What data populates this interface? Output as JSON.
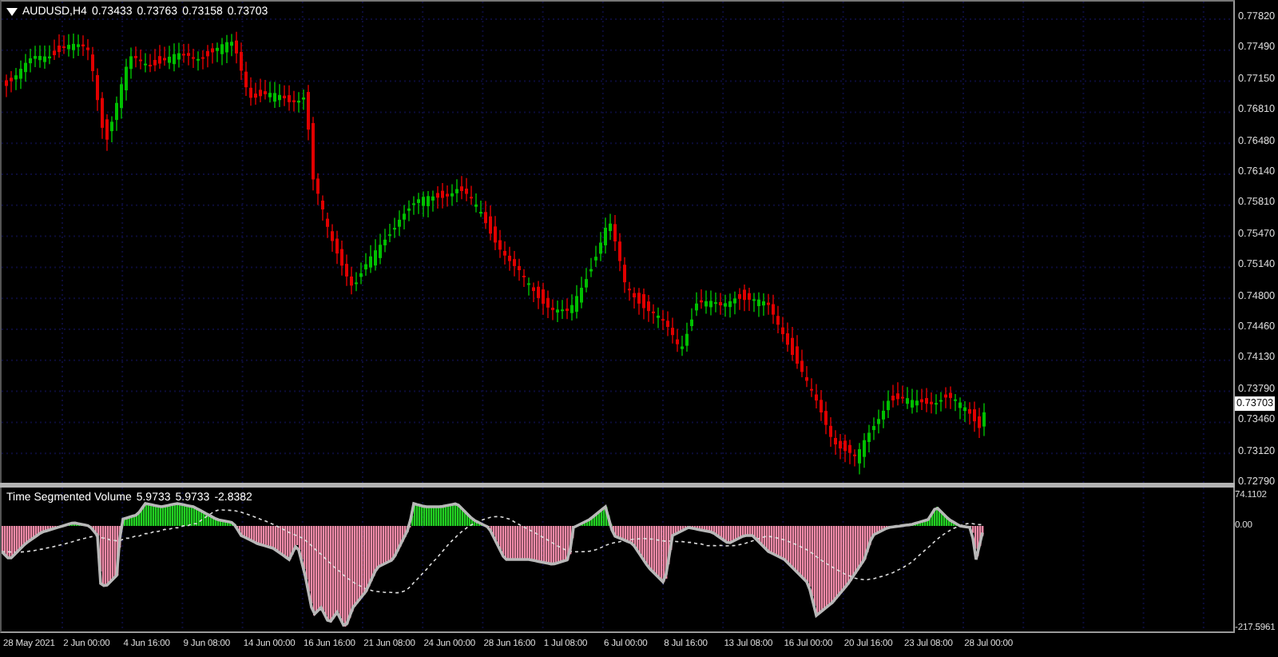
{
  "chart": {
    "symbol": "AUDUSD,H4",
    "ohlc": [
      "0.73433",
      "0.73763",
      "0.73158",
      "0.73703"
    ],
    "price_ticks": [
      "0.77820",
      "0.77490",
      "0.77150",
      "0.76810",
      "0.76480",
      "0.76140",
      "0.75810",
      "0.75470",
      "0.75140",
      "0.74800",
      "0.74460",
      "0.74130",
      "0.73790",
      "0.73460",
      "0.73120",
      "0.72790"
    ],
    "current_price": "0.73703"
  },
  "indicator": {
    "title": "Time Segmented Volume",
    "values": [
      "5.9733",
      "5.9733",
      "-2.8382"
    ],
    "scale_ticks": [
      "74.1102",
      "0.00",
      "-217.5961"
    ]
  },
  "time_axis": {
    "labels": [
      "28 May 2021",
      "2 Jun 00:00",
      "4 Jun 16:00",
      "9 Jun 08:00",
      "14 Jun 00:00",
      "16 Jun 16:00",
      "21 Jun 08:00",
      "24 Jun 00:00",
      "28 Jun 16:00",
      "1 Jul 08:00",
      "6 Jul 00:00",
      "8 Jul 16:00",
      "13 Jul 08:00",
      "16 Jul 00:00",
      "20 Jul 16:00",
      "23 Jul 08:00",
      "28 Jul 00:00"
    ]
  }
}
